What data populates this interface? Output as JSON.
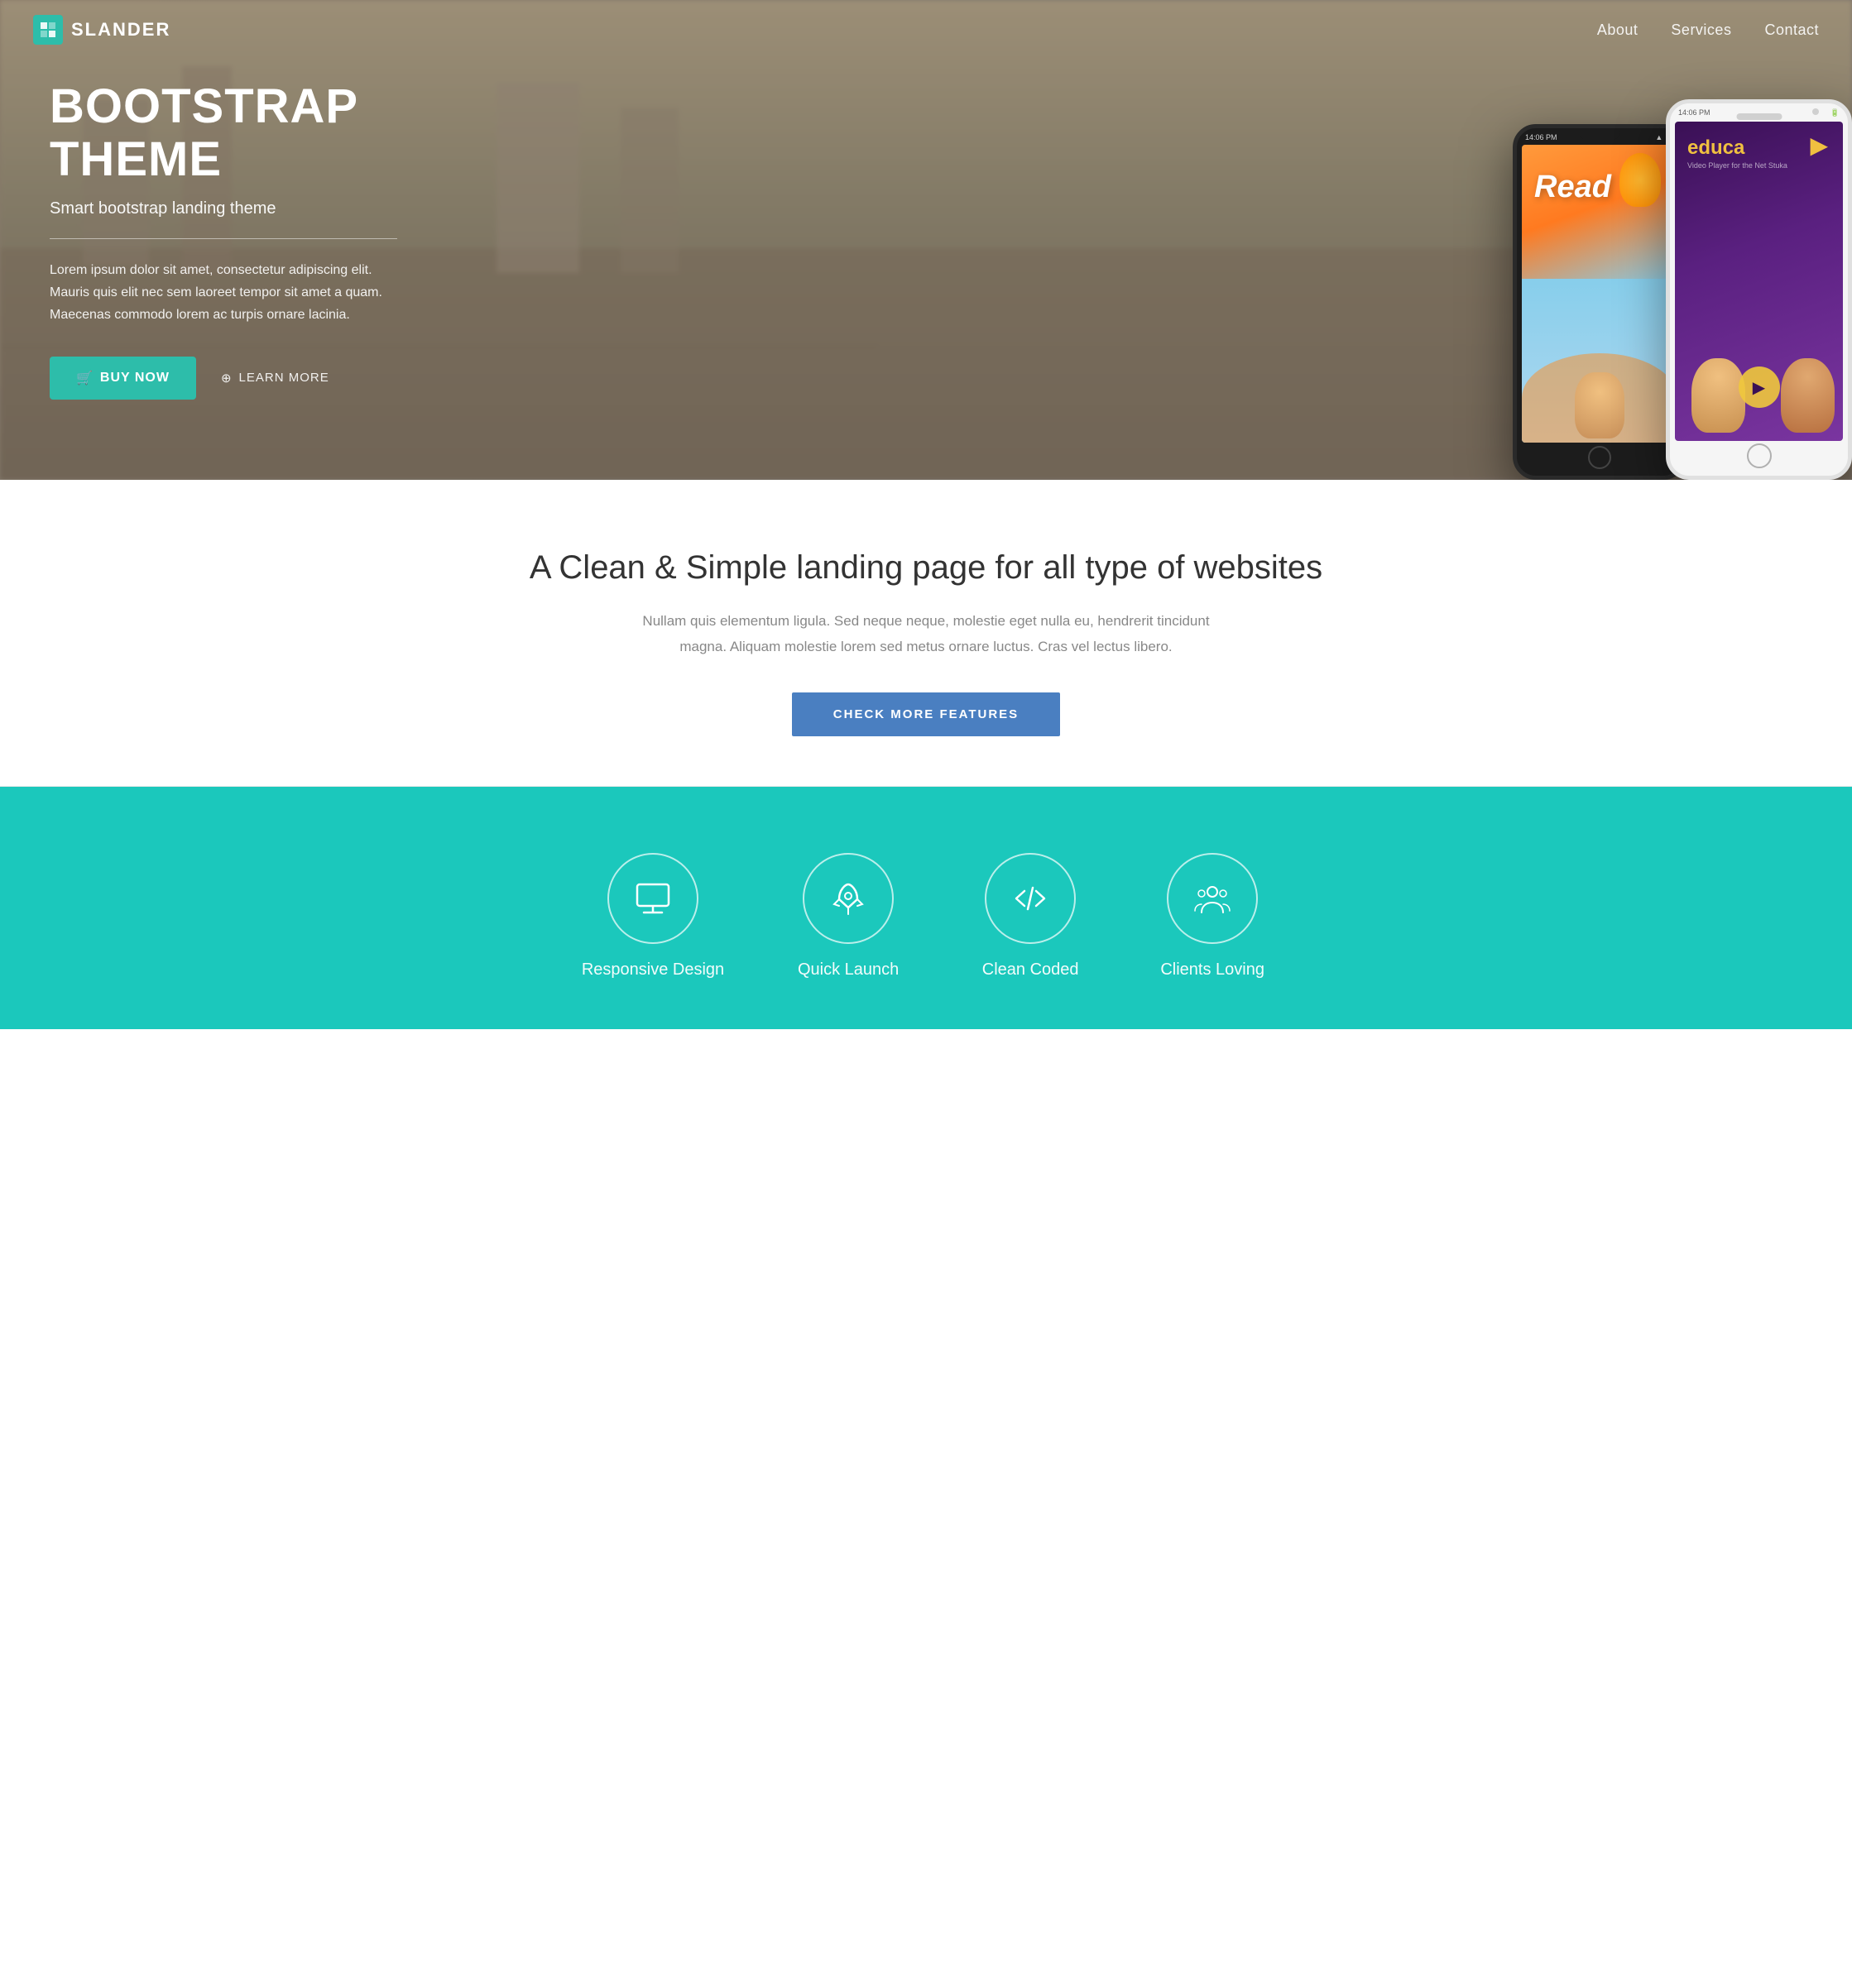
{
  "navbar": {
    "brand_name": "SLANDER",
    "brand_logo_text": "S",
    "nav_items": [
      {
        "label": "About",
        "href": "#about"
      },
      {
        "label": "Services",
        "href": "#services"
      },
      {
        "label": "Contact",
        "href": "#contact"
      }
    ]
  },
  "hero": {
    "title": "BOOTSTRAP\nTHEME",
    "subtitle": "Smart bootstrap landing theme",
    "description": "Lorem ipsum dolor sit amet, consectetur adipiscing elit. Mauris quis elit nec sem laoreet tempor sit amet a quam. Maecenas commodo lorem ac turpis ornare lacinia.",
    "buy_btn": "BUY NOW",
    "learn_btn": "LEARN MORE"
  },
  "tagline": {
    "heading": "A Clean & Simple landing page for all type of websites",
    "description": "Nullam quis elementum ligula. Sed neque neque, molestie eget nulla eu, hendrerit tincidunt magna.\nAliquam molestie lorem sed metus ornare luctus. Cras vel lectus libero.",
    "check_btn": "CHECK MORE FEATURES"
  },
  "features": {
    "items": [
      {
        "label": "Responsive Design",
        "icon": "monitor"
      },
      {
        "label": "Quick Launch",
        "icon": "rocket"
      },
      {
        "label": "Clean Coded",
        "icon": "code"
      },
      {
        "label": "Clients Loving",
        "icon": "people"
      }
    ]
  }
}
